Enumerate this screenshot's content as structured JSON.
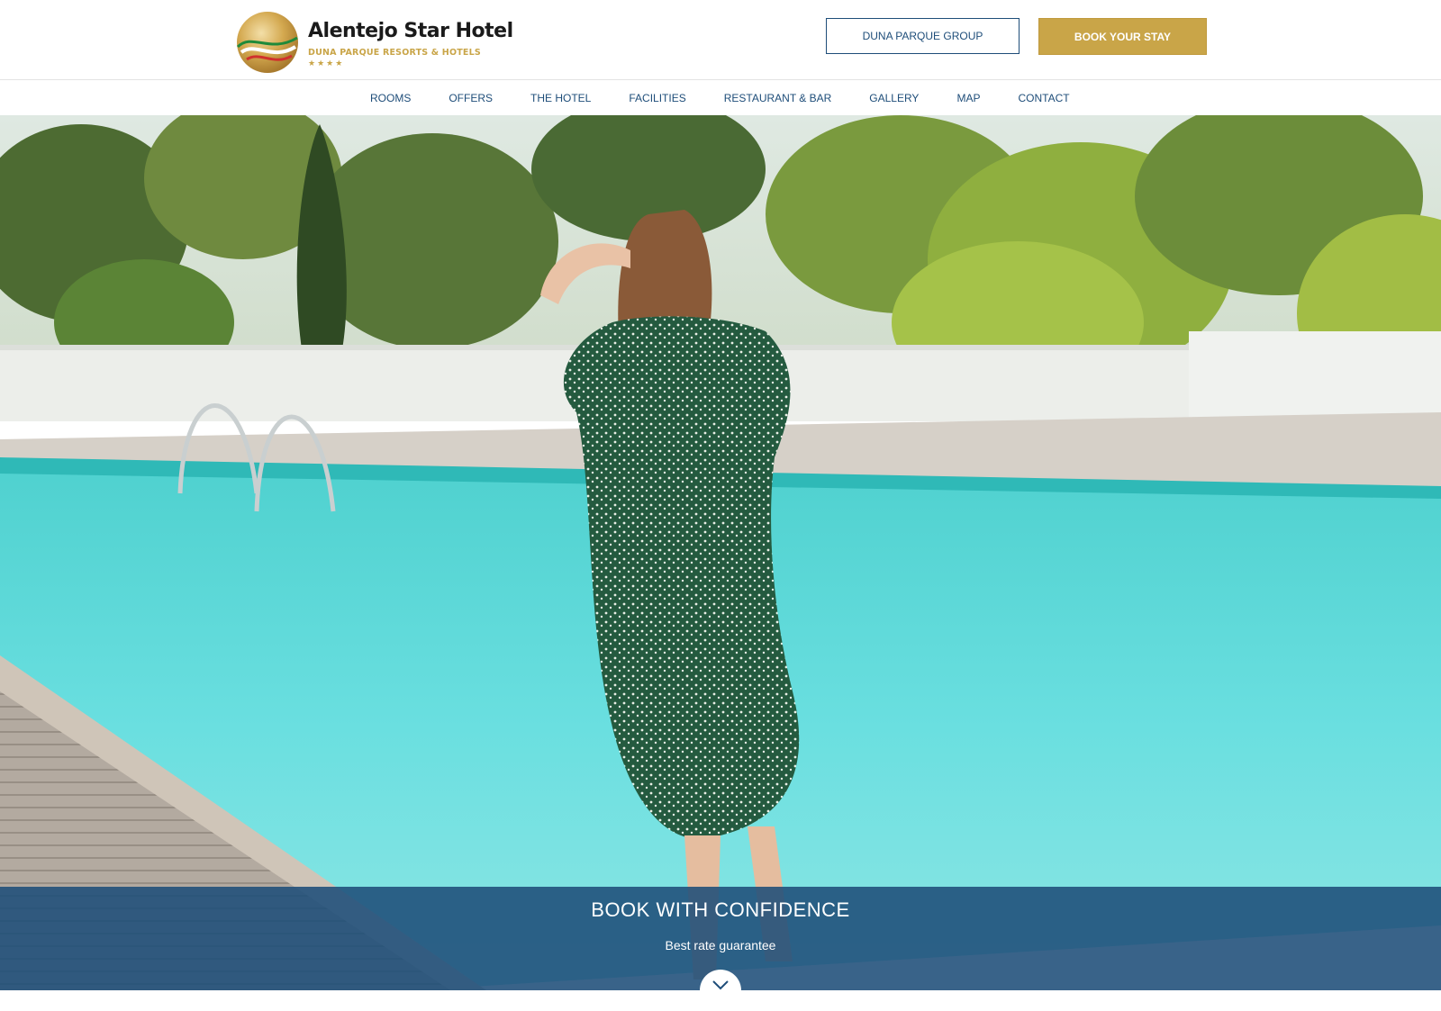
{
  "header": {
    "logo": {
      "title": "Alentejo Star Hotel",
      "subtitle": "DUNA PARQUE RESORTS & HOTELS",
      "stars": "★★★★"
    },
    "group_button": "DUNA PARQUE GROUP",
    "book_button": "BOOK YOUR STAY"
  },
  "nav": {
    "items": [
      "ROOMS",
      "OFFERS",
      "THE HOTEL",
      "FACILITIES",
      "RESTAURANT & BAR",
      "GALLERY",
      "MAP",
      "CONTACT"
    ]
  },
  "banner": {
    "title": "BOOK WITH CONFIDENCE",
    "subtitle": "Best rate guarantee",
    "scroll_icon": "chevron-down-icon"
  },
  "colors": {
    "brand_blue": "#1e4d79",
    "brand_gold": "#c9a548"
  }
}
